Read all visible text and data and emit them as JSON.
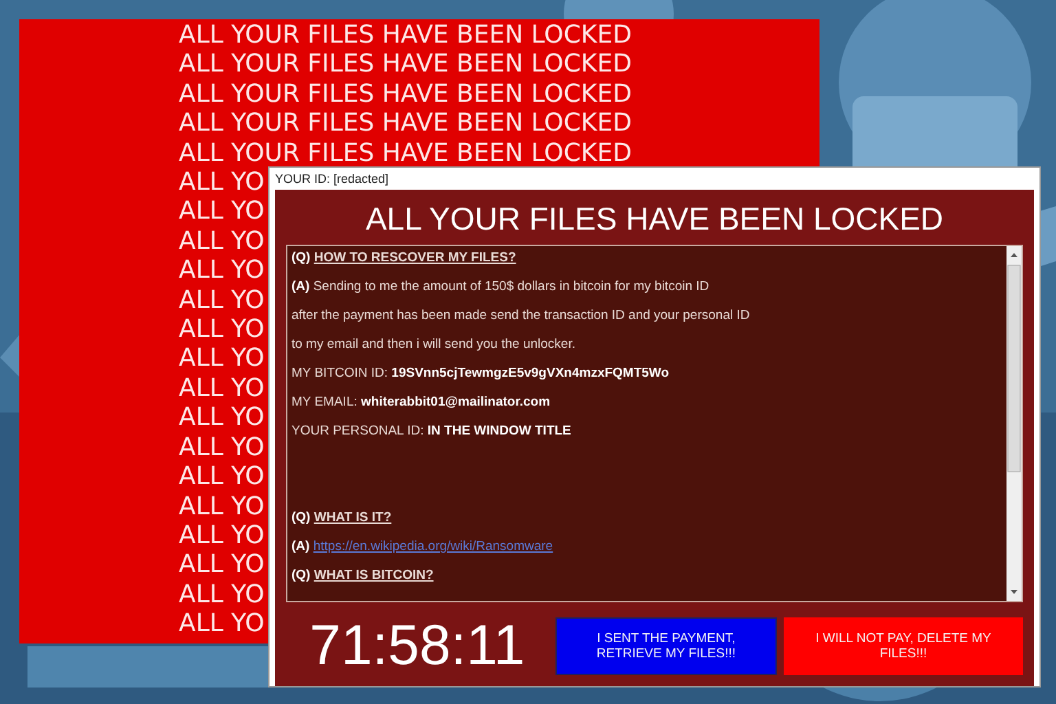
{
  "banner": {
    "lines": [
      "ALL YOUR FILES HAVE BEEN LOCKED",
      "ALL YOUR FILES HAVE BEEN LOCKED",
      "ALL YOUR FILES HAVE BEEN LOCKED",
      "ALL YOUR FILES HAVE BEEN LOCKED",
      "ALL YOUR FILES HAVE BEEN LOCKED",
      "ALL YO",
      "ALL YO",
      "ALL YO",
      "ALL YO",
      "ALL YO",
      "ALL YO",
      "ALL YO",
      "ALL YO",
      "ALL YO",
      "ALL YO",
      "ALL YO",
      "ALL YO",
      "ALL YO",
      "ALL YO",
      "ALL YO",
      "ALL YO"
    ]
  },
  "window": {
    "title": "YOUR ID: [redacted]",
    "headline": "ALL YOUR FILES HAVE BEEN LOCKED",
    "message": [
      {
        "kind": "question",
        "prefix": "(Q)",
        "text": "HOW TO RESCOVER MY FILES?"
      },
      {
        "kind": "text",
        "text": "**(A)** Sending to me the amount of 150$ dollars in bitcoin for my bitcoin ID"
      },
      {
        "kind": "text",
        "text": "after the payment has been made send  the transaction ID and your personal ID"
      },
      {
        "kind": "text",
        "text": "to my email and then i will send you the unlocker."
      },
      {
        "kind": "text",
        "text": "MY BITCOIN ID: **19SVnn5cjTewmgzE5v9gVXn4mzxFQMT5Wo**"
      },
      {
        "kind": "text",
        "text": "MY EMAIL: **whiterabbit01@mailinator.com**"
      },
      {
        "kind": "text",
        "text": "YOUR PERSONAL ID: **IN THE WINDOW TITLE**"
      },
      {
        "kind": "blank"
      },
      {
        "kind": "blank"
      },
      {
        "kind": "question",
        "prefix": "(Q)",
        "text": "WHAT IS IT?"
      },
      {
        "kind": "link",
        "prefix": "(A)",
        "text": "https://en.wikipedia.org/wiki/Ransomware"
      },
      {
        "kind": "question",
        "prefix": "(Q)",
        "text": "WHAT IS BITCOIN?"
      }
    ],
    "timer": "71:58:11",
    "buttons": [
      {
        "label": "I SENT THE PAYMENT, RETRIEVE MY FILES!!!",
        "kind": "pay"
      },
      {
        "label": "I WILL NOT PAY, DELETE MY FILES!!!",
        "kind": "delete"
      }
    ]
  }
}
